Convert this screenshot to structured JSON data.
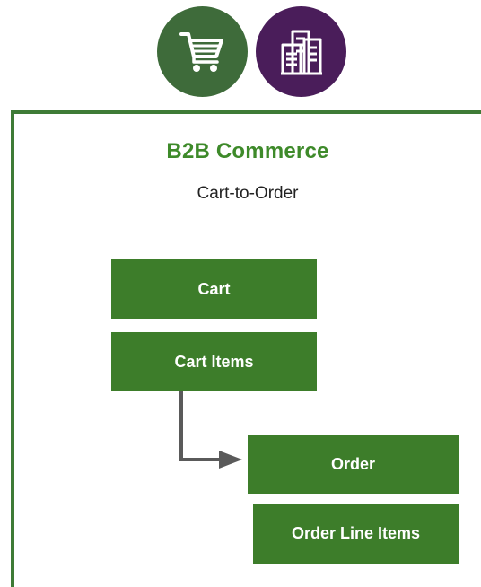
{
  "icons": {
    "cart": {
      "name": "shopping-cart-icon",
      "bg_color": "#3e6b3a",
      "fg_color": "#ffffff"
    },
    "building": {
      "name": "building-icon",
      "bg_color": "#4a1d5a",
      "fg_color": "#ffffff"
    }
  },
  "diagram": {
    "title": "B2B Commerce",
    "subtitle": "Cart-to-Order",
    "title_color": "#3e8a2a",
    "box_color": "#3d7d2a",
    "frame_color": "#3e7b36",
    "arrow_color": "#5a5a5a",
    "boxes": {
      "cart": "Cart",
      "cart_items": "Cart Items",
      "order": "Order",
      "order_line_items": "Order Line Items"
    }
  }
}
